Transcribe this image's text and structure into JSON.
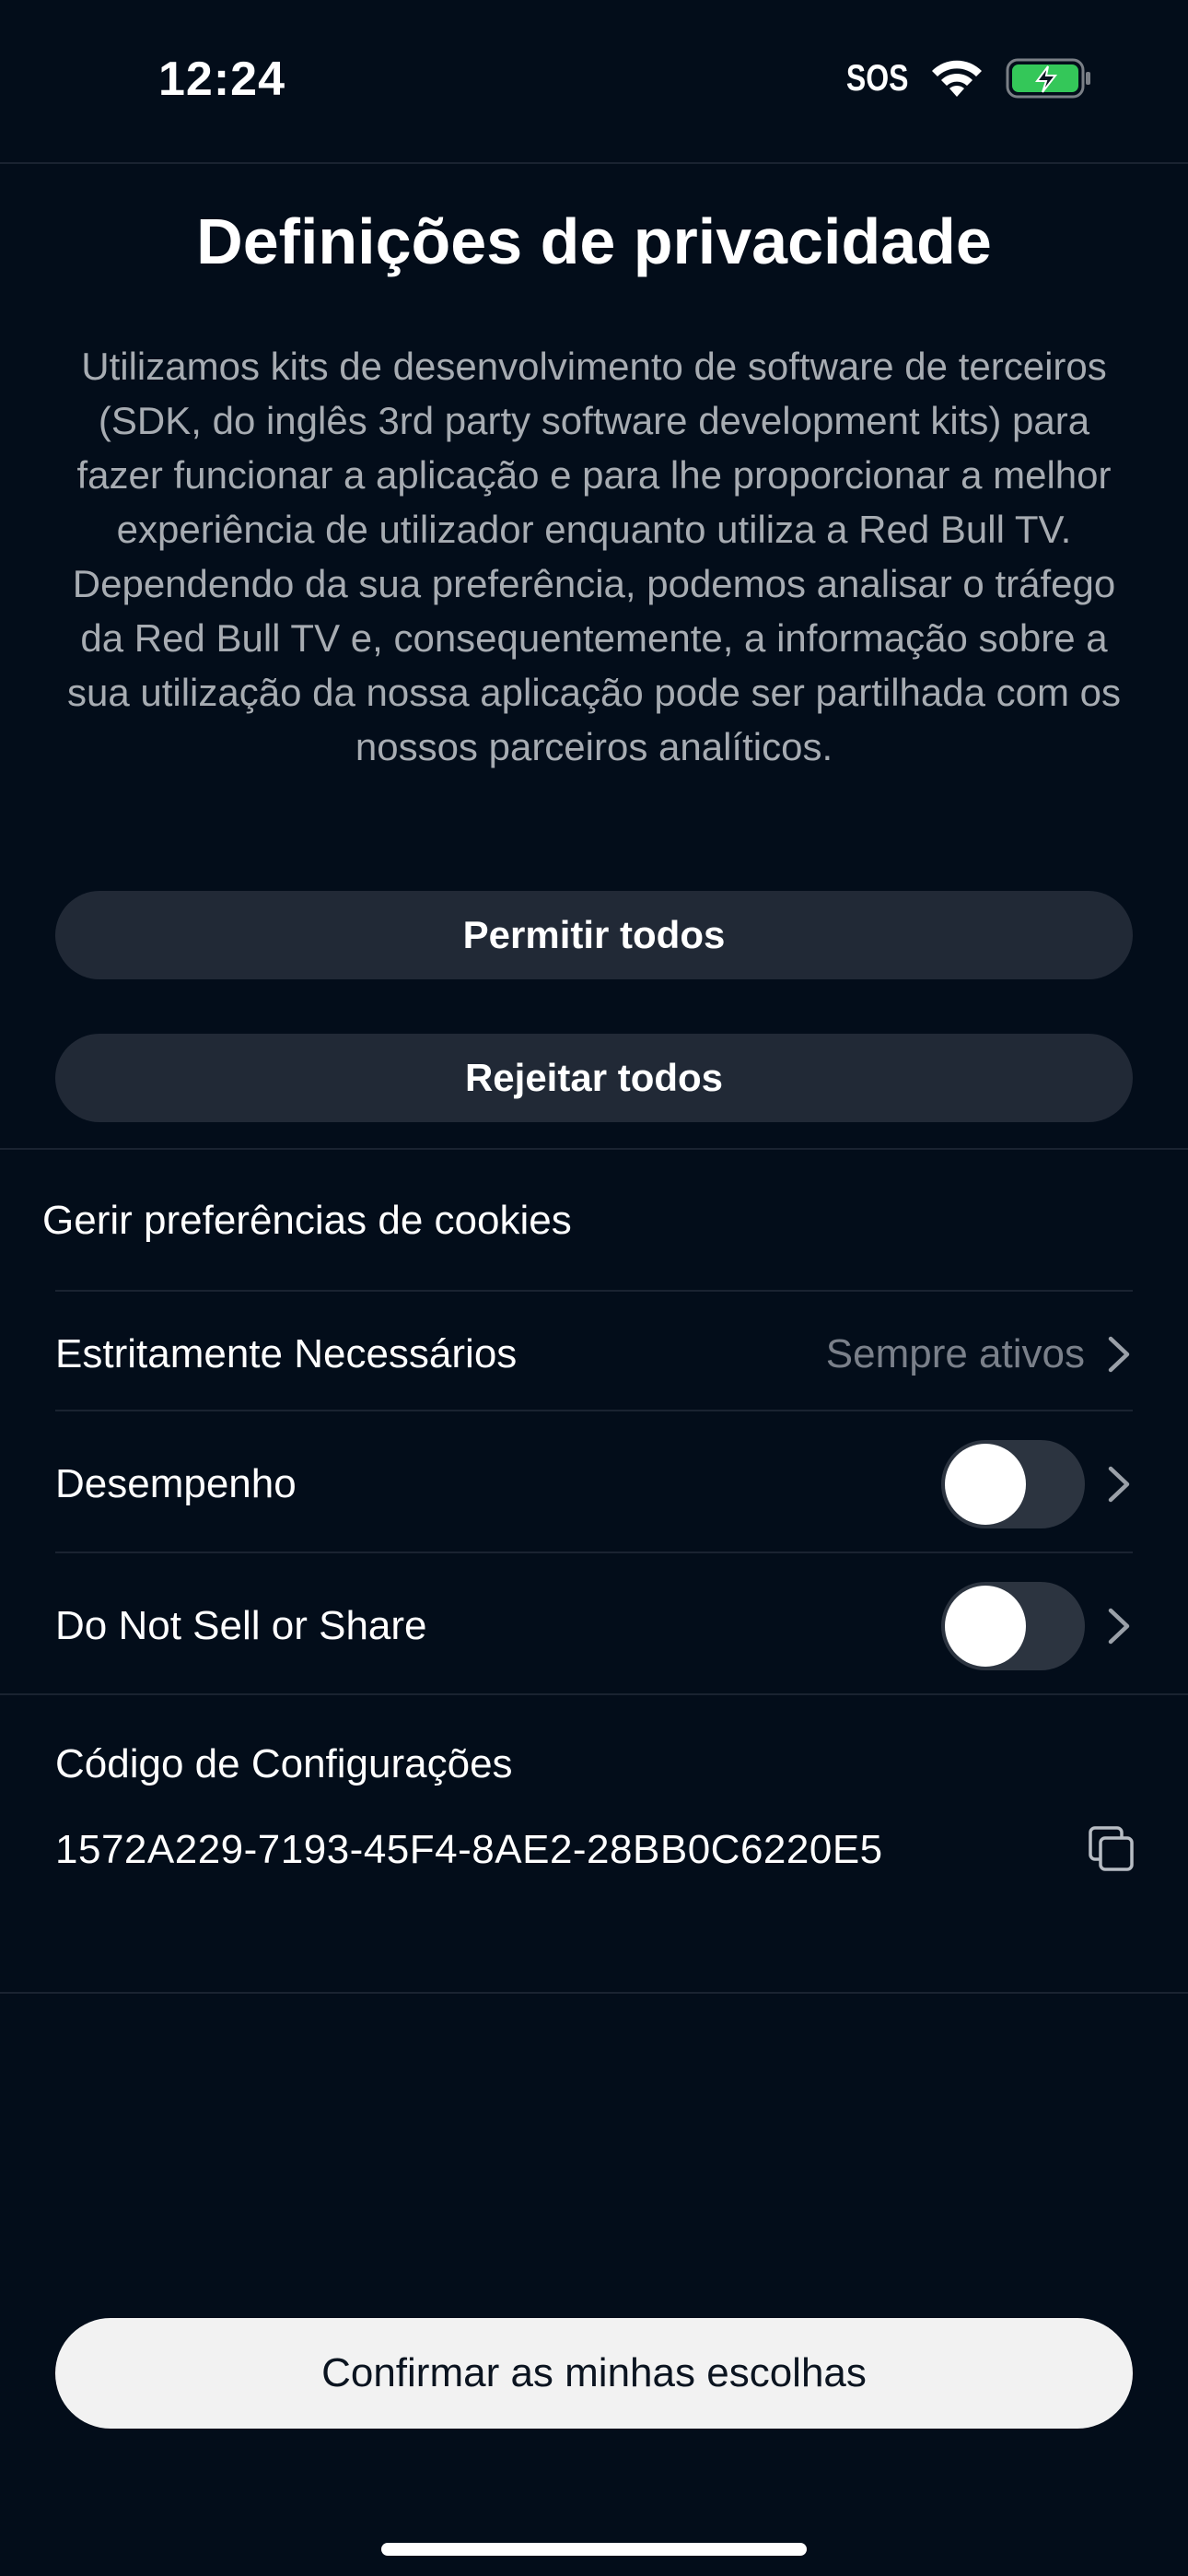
{
  "status_bar": {
    "time": "12:24",
    "sos": "SOS",
    "battery_color": "#34c759"
  },
  "privacy": {
    "title": "Definições de privacidade",
    "description": "Utilizamos kits de desenvolvimento de software de terceiros (SDK, do inglês 3rd party software development kits) para fazer funcionar a aplicação e para lhe proporcionar a melhor experiência de utilizador enquanto utiliza a Red Bull TV. Dependendo da sua preferência, podemos analisar o tráfego da Red Bull TV e, consequentemente, a informação sobre a sua utilização da nossa aplicação pode ser partilhada com os nossos parceiros analíticos.",
    "allow_all_label": "Permitir todos",
    "reject_all_label": "Rejeitar todos"
  },
  "cookies": {
    "header": "Gerir preferências de cookies",
    "rows": [
      {
        "label": "Estritamente Necessários",
        "status": "Sempre ativos"
      },
      {
        "label": "Desempenho",
        "enabled": false
      },
      {
        "label": "Do Not Sell or Share",
        "enabled": false
      }
    ]
  },
  "config": {
    "label": "Código de Configurações",
    "code": "1572A229-7193-45F4-8AE2-28BB0C6220E5"
  },
  "footer": {
    "confirm_label": "Confirmar as minhas escolhas"
  }
}
